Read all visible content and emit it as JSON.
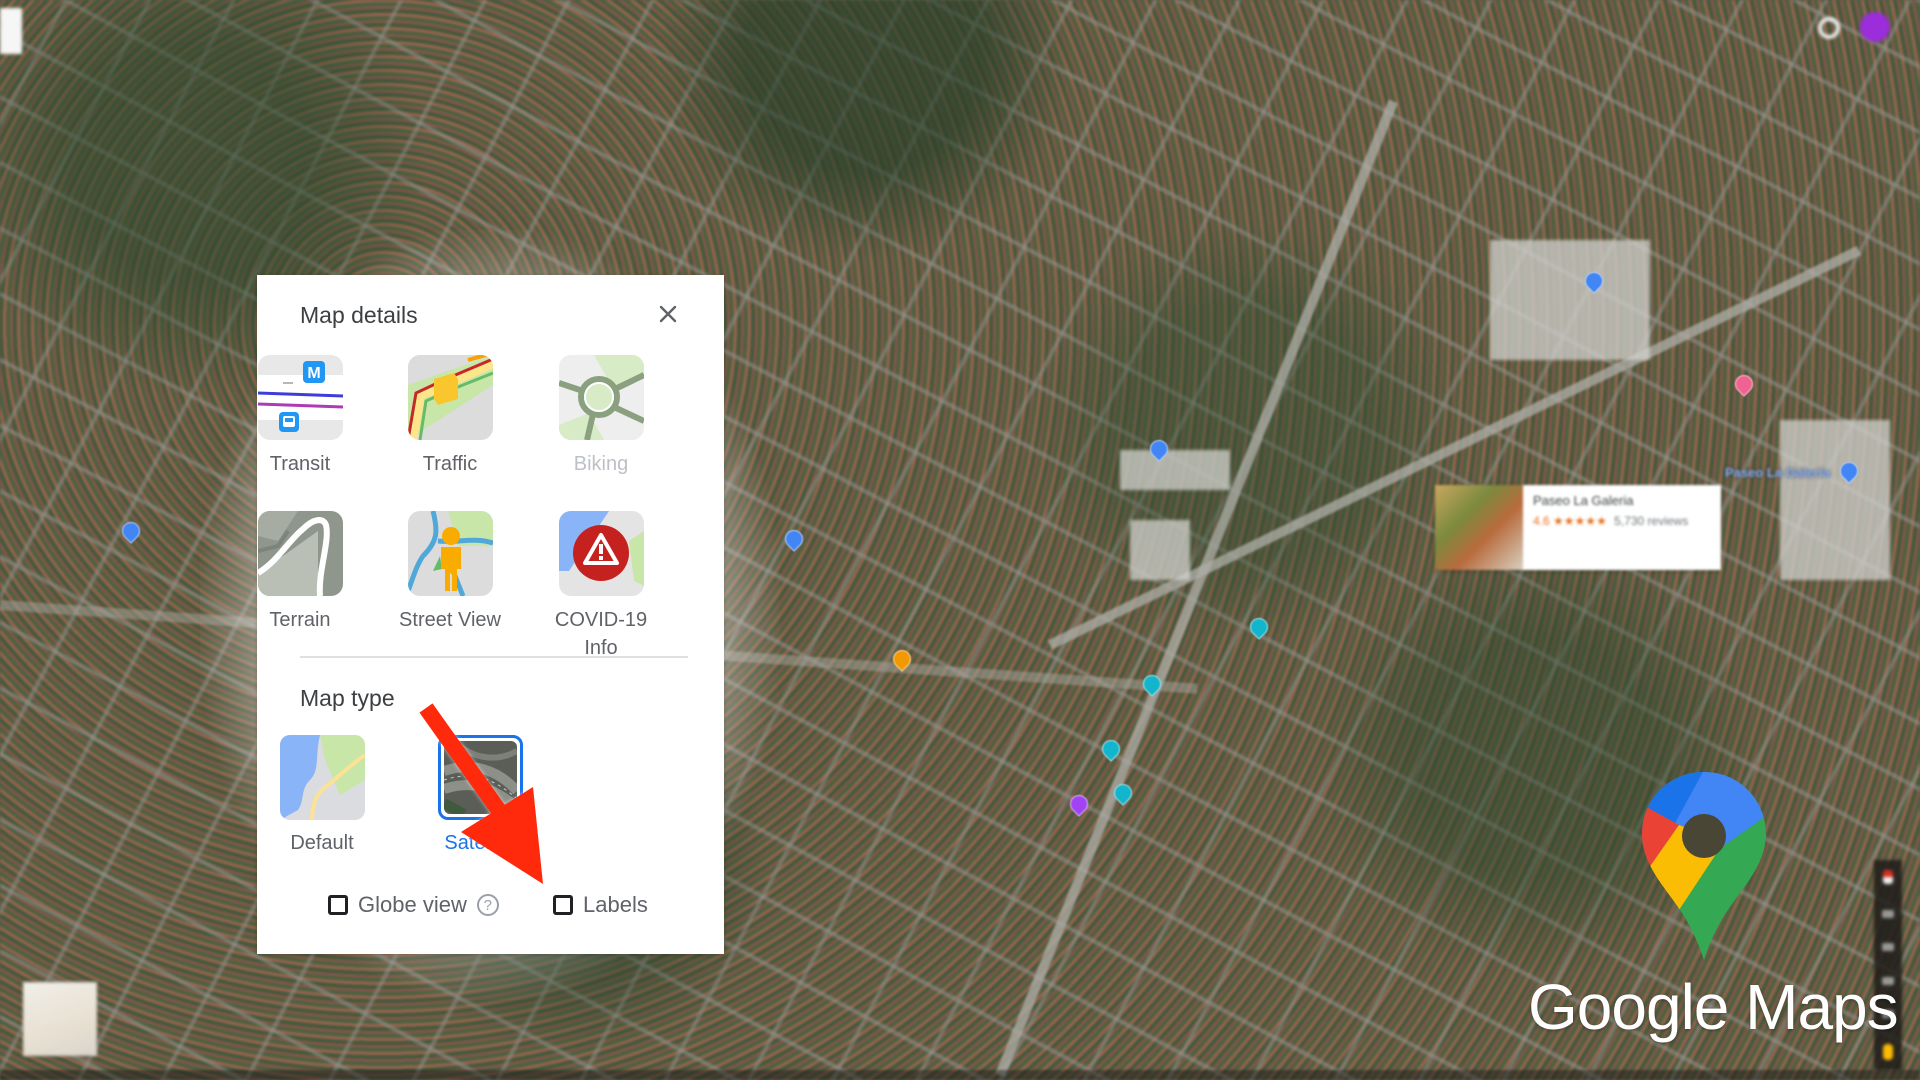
{
  "panel": {
    "title": "Map details",
    "close_icon": "close-icon",
    "details": [
      {
        "label": "Transit",
        "icon": "transit-icon",
        "enabled": true
      },
      {
        "label": "Traffic",
        "icon": "traffic-icon",
        "enabled": true
      },
      {
        "label": "Biking",
        "icon": "biking-icon",
        "enabled": false
      },
      {
        "label": "Terrain",
        "icon": "terrain-icon",
        "enabled": true
      },
      {
        "label": "Street View",
        "icon": "street-view-icon",
        "enabled": true
      },
      {
        "label": "COVID-19 Info",
        "icon": "covid-info-icon",
        "enabled": true
      }
    ],
    "map_type_title": "Map type",
    "map_types": [
      {
        "label": "Default",
        "selected": false
      },
      {
        "label": "Satellite",
        "selected": true
      }
    ],
    "options": {
      "globe_view": {
        "label": "Globe view",
        "checked": false,
        "help": "?"
      },
      "labels": {
        "label": "Labels",
        "checked": false
      }
    }
  },
  "map": {
    "place_card": {
      "name": "Paseo La Galeria",
      "rating": "4.6",
      "stars": "★★★★★",
      "reviews": "5,730 reviews"
    },
    "poi_label": "Paseo La Galeria"
  },
  "annotation": {
    "type": "red-arrow",
    "points_to": "Labels checkbox",
    "color": "#ff2a0c"
  },
  "brand": {
    "name": "Google Maps"
  },
  "colors": {
    "accent": "#1a73e8",
    "text": "#3c4043",
    "label": "#5f6368",
    "disabled": "#bdc1c6",
    "arrow": "#ff2a0c"
  }
}
